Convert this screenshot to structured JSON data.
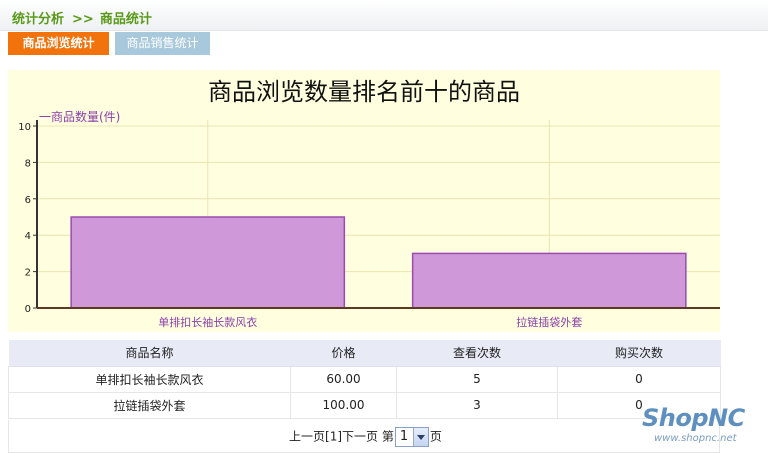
{
  "breadcrumb": {
    "section": "统计分析",
    "separator": ">>",
    "current": "商品统计"
  },
  "tabs": [
    {
      "label": "商品浏览统计",
      "active": true
    },
    {
      "label": "商品销售统计",
      "active": false
    }
  ],
  "chart_data": {
    "type": "bar",
    "title": "商品浏览数量排名前十的商品",
    "legend": "商品数量(件)",
    "categories": [
      "单排扣长袖长款风衣",
      "拉链插袋外套"
    ],
    "values": [
      5,
      3
    ],
    "ylim": [
      0,
      10
    ],
    "yticks": [
      0,
      2,
      4,
      6,
      8,
      10
    ],
    "grid": true,
    "bar_color": "#cf98d8",
    "bar_stroke": "#9b4bb0",
    "background": "#ffffe0"
  },
  "table": {
    "headers": [
      "商品名称",
      "价格",
      "查看次数",
      "购买次数"
    ],
    "rows": [
      [
        "单排扣长袖长款风衣",
        "60.00",
        "5",
        "0"
      ],
      [
        "拉链插袋外套",
        "100.00",
        "3",
        "0"
      ]
    ]
  },
  "pager": {
    "prev": "上一页",
    "current_page": "[1]",
    "next": "下一页",
    "page_prefix": "第",
    "page_select": "1",
    "page_suffix": "页"
  },
  "watermark": {
    "logo": "ShopNC",
    "url": "www.shopnc.net"
  }
}
